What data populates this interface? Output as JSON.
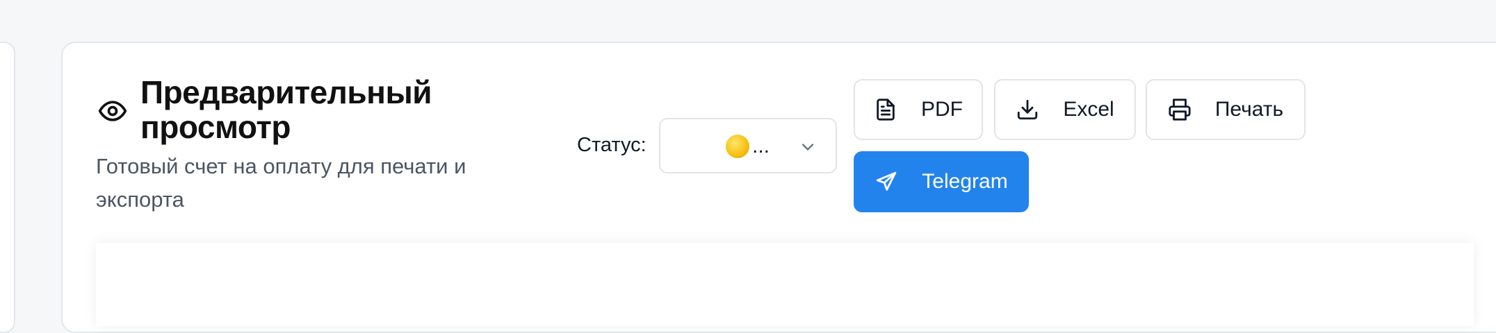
{
  "header": {
    "title": "Предварительный просмотр",
    "subtitle": "Готовый счет на оплату для печати и экспорта",
    "icon": "eye-icon"
  },
  "status": {
    "label": "Статус:",
    "value": "...",
    "indicator_color": "#f7c214"
  },
  "actions": {
    "pdf": {
      "label": "PDF",
      "icon": "file-text-icon"
    },
    "excel": {
      "label": "Excel",
      "icon": "download-icon"
    },
    "print": {
      "label": "Печать",
      "icon": "printer-icon"
    },
    "telegram": {
      "label": "Telegram",
      "icon": "send-icon",
      "color": "#2383ed"
    }
  }
}
